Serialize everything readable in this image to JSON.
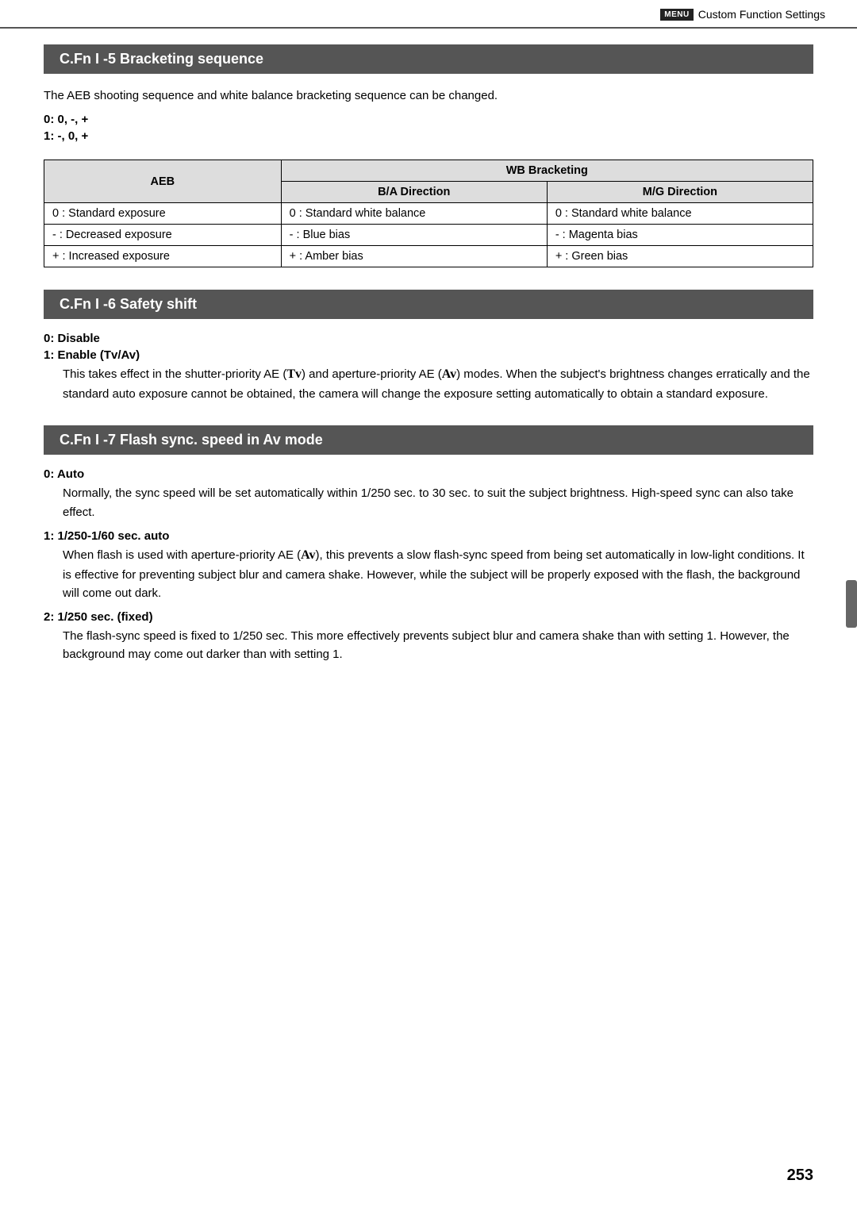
{
  "header": {
    "menu_icon_label": "MENU",
    "title": "Custom Function Settings"
  },
  "sections": {
    "s1": {
      "id": "C.Fn I -5",
      "title": "C.Fn I -5  Bracketing sequence",
      "description": "The AEB shooting sequence and white balance bracketing sequence can be changed.",
      "options": [
        {
          "label": "0: 0, -, +"
        },
        {
          "label": "1: -, 0, +"
        }
      ],
      "table": {
        "col1_header": "AEB",
        "col2_group": "WB Bracketing",
        "col2_sub1": "B/A Direction",
        "col2_sub2": "M/G Direction",
        "rows": [
          {
            "aeb": "0 : Standard exposure",
            "ba": "0 : Standard white balance",
            "mg": "0 : Standard white balance"
          },
          {
            "aeb": "- : Decreased exposure",
            "ba": "- : Blue bias",
            "mg": "- : Magenta bias"
          },
          {
            "aeb": "+ : Increased exposure",
            "ba": "+ : Amber bias",
            "mg": "+ : Green bias"
          }
        ]
      }
    },
    "s2": {
      "id": "C.Fn I -6",
      "title": "C.Fn I -6  Safety shift",
      "options": [
        {
          "label": "0: Disable",
          "desc": ""
        },
        {
          "label": "1: Enable (Tv/Av)",
          "desc": "This takes effect in the shutter-priority AE (Tv) and aperture-priority AE (Av) modes. When the subject's brightness changes erratically and the standard auto exposure cannot be obtained, the camera will change the exposure setting automatically to obtain a standard exposure."
        }
      ]
    },
    "s3": {
      "id": "C.Fn I -7",
      "title": "C.Fn I -7  Flash sync. speed in Av mode",
      "options": [
        {
          "label": "0: Auto",
          "desc": "Normally, the sync speed will be set automatically within 1/250 sec. to 30 sec. to suit the subject brightness. High-speed sync can also take effect."
        },
        {
          "label": "1: 1/250-1/60 sec. auto",
          "desc": "When flash is used with aperture-priority AE (Av), this prevents a slow flash-sync speed from being set automatically in low-light conditions. It is effective for preventing subject blur and camera shake. However, while the subject will be properly exposed with the flash, the background will come out dark."
        },
        {
          "label": "2: 1/250 sec. (fixed)",
          "desc": "The flash-sync speed is fixed to 1/250 sec. This more effectively prevents subject blur and camera shake than with setting 1. However, the background may come out darker than with setting 1."
        }
      ]
    }
  },
  "page_number": "253"
}
